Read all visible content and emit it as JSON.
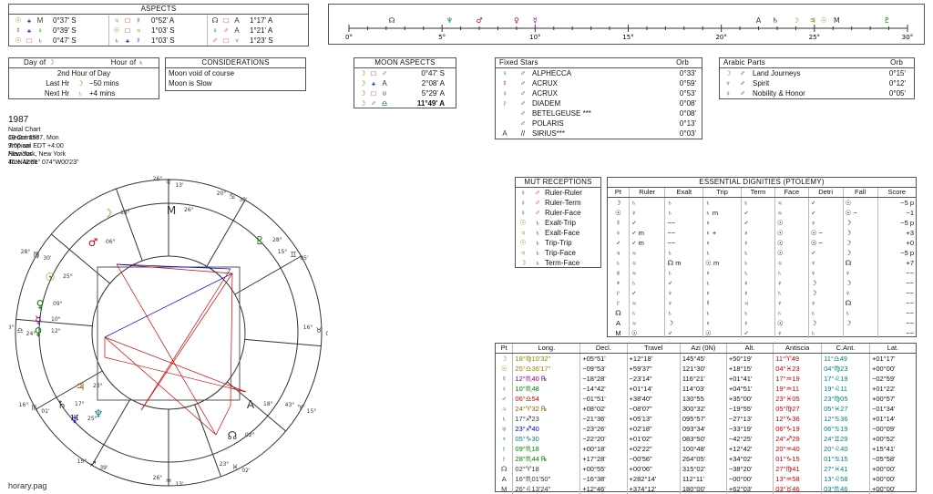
{
  "aspects": {
    "title": "ASPECTS",
    "cols": [
      [
        {
          "p1": "☉",
          "c1": "sun",
          "a": "⚹",
          "ca": "asp-b",
          "p2": "M",
          "c2": "sat",
          "orb": "0°37' S"
        },
        {
          "p1": "☿",
          "c1": "merc",
          "a": "⚹",
          "ca": "asp-b",
          "p2": "♀",
          "c2": "ven",
          "orb": "0°39' S"
        },
        {
          "p1": "☉",
          "c1": "sun",
          "a": "□",
          "ca": "asp-r",
          "p2": "♄",
          "c2": "sat",
          "orb": "0°47' S"
        }
      ],
      [
        {
          "p1": "♃",
          "c1": "jup",
          "a": "□",
          "ca": "asp-r",
          "p2": "☿",
          "c2": "merc",
          "orb": "0°52' A"
        },
        {
          "p1": "☉",
          "c1": "sun",
          "a": "□",
          "ca": "asp-r",
          "p2": "♃",
          "c2": "jup",
          "orb": "1°03' S"
        },
        {
          "p1": "♄",
          "c1": "sat",
          "a": "⚹",
          "ca": "asp-b",
          "p2": "☿",
          "c2": "merc",
          "orb": "1°03' S"
        }
      ],
      [
        {
          "p1": "☊",
          "c1": "sat",
          "a": "□",
          "ca": "asp-r",
          "p2": "A",
          "c2": "sat",
          "orb": "1°17' A"
        },
        {
          "p1": "♀",
          "c1": "ven",
          "a": "♂",
          "ca": "asp-r",
          "p2": "A",
          "c2": "sat",
          "orb": "1°21' A"
        },
        {
          "p1": "♂",
          "c1": "mars",
          "a": "□",
          "ca": "asp-r",
          "p2": "♆",
          "c2": "nep",
          "orb": "1°23' S"
        }
      ]
    ]
  },
  "timeline": {
    "ticks": [
      "0°",
      "5°",
      "10°",
      "15°",
      "20°",
      "25°",
      "30°"
    ],
    "markers": [
      {
        "g": "☊",
        "pos": 2.3,
        "c": "sat"
      },
      {
        "g": "♆",
        "pos": 5.4,
        "c": "nep"
      },
      {
        "g": "♂",
        "pos": 7.0,
        "c": "mars"
      },
      {
        "g": "♀",
        "pos": 9.0,
        "c": "mars"
      },
      {
        "g": "☿",
        "pos": 10.0,
        "c": "merc"
      },
      {
        "g": "A",
        "pos": 22.0,
        "c": "sat"
      },
      {
        "g": "♄",
        "pos": 22.9,
        "c": "sat"
      },
      {
        "g": "☽",
        "pos": 24.0,
        "c": "moon"
      },
      {
        "g": "☉",
        "pos": 25.5,
        "c": "sun"
      },
      {
        "g": "♃",
        "pos": 24.9,
        "c": "jup"
      },
      {
        "g": "M",
        "pos": 26.2,
        "c": "sat"
      },
      {
        "g": "♇",
        "pos": 28.9,
        "c": "ven"
      }
    ]
  },
  "day_of": {
    "title_left": "Day of",
    "title_right": "Hour of",
    "day_glyph": "☽",
    "hour_glyph": "♄",
    "rows": [
      {
        "label": "2nd Hour of Day",
        "g": "",
        "v": ""
      },
      {
        "label": "Last Hr",
        "g": "☽",
        "v": "−50 mins"
      },
      {
        "label": "Next Hr",
        "g": "♄",
        "v": "+4 mins"
      }
    ]
  },
  "considerations": {
    "title": "CONSIDERATIONS",
    "items": [
      "Moon void of course",
      "Moon is Slow"
    ]
  },
  "moon_aspects": {
    "title": "MOON ASPECTS",
    "rows": [
      {
        "p1": "☽",
        "a": "□",
        "ca": "asp-r",
        "p2": "♂",
        "c2": "mars",
        "orb": "0°47' S",
        "bold": false
      },
      {
        "p1": "☽",
        "a": "⚹",
        "ca": "asp-b",
        "p2": "A",
        "c2": "sat",
        "orb": "2°08' A",
        "bold": false
      },
      {
        "p1": "☽",
        "a": "□",
        "ca": "asp-r",
        "p2": "♅",
        "c2": "ura",
        "orb": "5°29' A",
        "bold": false
      },
      {
        "p1": "☽",
        "a": "♂",
        "ca": "sat",
        "p2": "♎",
        "c2": "ven",
        "orb": "11°49' A",
        "bold": true
      }
    ]
  },
  "fixed_stars": {
    "title": "Fixed Stars",
    "orb_label": "Orb",
    "rows": [
      {
        "p": "♀",
        "c": "ven",
        "a": "♂",
        "star": "ALPHECCA",
        "orb": "0°33'"
      },
      {
        "p": "☿",
        "c": "merc",
        "a": "♂",
        "star": "ACRUX",
        "orb": "0°59'"
      },
      {
        "p": "♀",
        "c": "ven",
        "a": "♂",
        "star": "ACRUX",
        "orb": "0°53'"
      },
      {
        "p": "♇",
        "c": "ven",
        "a": "♂",
        "star": "DIADEM",
        "orb": "0°08'"
      },
      {
        "p": "",
        "c": "sat",
        "a": "♂",
        "star": "BETELGEUSE ***",
        "orb": "0°08'"
      },
      {
        "p": "",
        "c": "sat",
        "a": "♂",
        "star": "POLARIS",
        "orb": "0°13'"
      },
      {
        "p": "A",
        "c": "sat",
        "a": "//",
        "star": "SIRIUS***",
        "orb": "0°03'"
      }
    ]
  },
  "arabic_parts": {
    "title": "Arabic Parts",
    "orb_label": "Orb",
    "rows": [
      {
        "p": "☽",
        "c": "moon",
        "a": "♂",
        "part": "Land Journeys",
        "orb": "0°15'"
      },
      {
        "p": "♆",
        "c": "nep",
        "a": "♂",
        "part": "Spirit",
        "orb": "0°12'"
      },
      {
        "p": "♀",
        "c": "ven",
        "a": "♂",
        "part": "Nobility & Honor",
        "orb": "0°05'"
      }
    ]
  },
  "chart_info": {
    "title": "1987",
    "lines": [
      "Natal Chart",
      "19 Oct 1987, Mon",
      "9:00 am  EDT +4:00",
      "New York, New York",
      "40°N42'51\" 074°W00'23\""
    ],
    "italic": [
      "Geocentric",
      "Tropical",
      "Placidus",
      "True Node"
    ]
  },
  "wheel": {
    "cusps": [
      {
        "label": "26°",
        "sign": "♌",
        "deg": "13'",
        "c": "sat"
      },
      {
        "label": "20°",
        "sign": "♋",
        "deg": "30'",
        "c": "sat"
      },
      {
        "label": "15°",
        "sign": "♊",
        "deg": "05'",
        "c": "sat"
      },
      {
        "label": "16°",
        "sign": "♉",
        "deg": "01'",
        "c": "sat"
      },
      {
        "label": "43°",
        "sign": "♈",
        "deg": "15°",
        "c": "sat"
      },
      {
        "label": "23°",
        "sign": "♓",
        "deg": "02'",
        "c": "sat"
      },
      {
        "label": "26°",
        "sign": "♒",
        "deg": "13'",
        "c": "sat"
      },
      {
        "label": "15°",
        "sign": "♐",
        "deg": "39'",
        "c": "sat"
      },
      {
        "label": "16°",
        "sign": "♏",
        "deg": "01'",
        "c": "sat"
      },
      {
        "label": "43°",
        "sign": "♎",
        "deg": "24°",
        "c": "sat"
      },
      {
        "label": "28°",
        "sign": "♍",
        "deg": "30'",
        "c": "sat"
      }
    ],
    "planets": [
      {
        "g": "☽",
        "c": "moon",
        "t": "18°"
      },
      {
        "g": "♂",
        "c": "mars",
        "t": "06°"
      },
      {
        "g": "☉",
        "c": "sun",
        "t": "25°"
      },
      {
        "g": "♀",
        "c": "ven",
        "t": "09°"
      },
      {
        "g": "☿",
        "c": "merc",
        "t": "10°"
      },
      {
        "g": "♀",
        "c": "ven",
        "t": "12°"
      },
      {
        "g": "♃",
        "c": "jup",
        "t": "23°"
      },
      {
        "g": "♄",
        "c": "sat",
        "t": "17°"
      },
      {
        "g": "♅",
        "c": "ura",
        "t": "25°"
      },
      {
        "g": "♆",
        "c": "nep",
        "t": ""
      },
      {
        "g": "♇",
        "c": "ven",
        "t": "28°"
      },
      {
        "g": "☊",
        "c": "sat",
        "t": "02°"
      },
      {
        "g": "A",
        "c": "sat",
        "t": "18°"
      },
      {
        "g": "M",
        "c": "sat",
        "t": "26°"
      }
    ]
  },
  "mut_receptions": {
    "title": "MUT RECEPTIONS",
    "rows": [
      {
        "p1": "♀",
        "c1": "ven",
        "p2": "♂",
        "c2": "mars",
        "txt": "Ruler-Ruler"
      },
      {
        "p1": "♀",
        "c1": "ven",
        "p2": "♂",
        "c2": "mars",
        "txt": "Ruler-Term"
      },
      {
        "p1": "♀",
        "c1": "ven",
        "p2": "♂",
        "c2": "mars",
        "txt": "Ruler-Face"
      },
      {
        "p1": "☉",
        "c1": "sun",
        "p2": "♄",
        "c2": "sat",
        "txt": "Exalt-Trip"
      },
      {
        "p1": "♃",
        "c1": "jup",
        "p2": "♄",
        "c2": "sat",
        "txt": "Exalt-Face"
      },
      {
        "p1": "☉",
        "c1": "sun",
        "p2": "♄",
        "c2": "sat",
        "txt": "Trip-Trip"
      },
      {
        "p1": "♃",
        "c1": "jup",
        "p2": "♄",
        "c2": "sat",
        "txt": "Trip-Face"
      },
      {
        "p1": "☽",
        "c1": "moon",
        "p2": "♄",
        "c2": "sat",
        "txt": "Term-Face"
      }
    ]
  },
  "dignities": {
    "title": "ESSENTIAL DIGNITIES (PTOLEMY)",
    "headers": [
      "Pt",
      "Ruler",
      "Exalt",
      "Trip",
      "Term",
      "Face",
      "Detri",
      "Fall",
      "Score"
    ],
    "rows": [
      [
        "☽",
        "♄",
        "♄",
        "♄",
        "♄",
        "♃",
        "♂",
        "☉",
        "−5 p"
      ],
      [
        "☉",
        "♀",
        "♄",
        "♄ m",
        "♂",
        "♃",
        "♂",
        "☉ −",
        "−1"
      ],
      [
        "☿",
        "♂",
        "−−",
        "♀",
        "♂",
        "☉",
        "♀",
        "☽",
        "−5 p"
      ],
      [
        "♀",
        "♂ m",
        "−−",
        "♀ +",
        "♀",
        "☉",
        "☉ −",
        "☽",
        "+3"
      ],
      [
        "♂",
        "♂ m",
        "−−",
        "♀",
        "♀",
        "☉",
        "☉ −",
        "☽",
        "+0"
      ],
      [
        "♃",
        "♃",
        "♄",
        "♄",
        "♄",
        "☉",
        "♂",
        "☽",
        "−5 p"
      ],
      [
        "♄",
        "♃",
        "☊ m",
        "☉ m",
        "♄",
        "♃",
        "♀",
        "☊",
        "+7"
      ],
      [
        "♅",
        "♃",
        "♄",
        "♀",
        "♄",
        "♄",
        "♀",
        "♀",
        "−−"
      ],
      [
        "♆",
        "♄",
        "♂",
        "♄",
        "♀",
        "♀",
        "☽",
        "☽",
        "−−"
      ],
      [
        "♇",
        "♂",
        "♀",
        "♀",
        "♀",
        "♄",
        "☽",
        "♀",
        "−−"
      ],
      [
        "♇",
        "♃",
        "♀",
        "☿",
        "♃",
        "♀",
        "♀",
        "☊",
        "−−"
      ],
      [
        "☊",
        "♄",
        "♄",
        "♄",
        "♄",
        "♄",
        "♄",
        "♄",
        "−−"
      ],
      [
        "A",
        "♃",
        "☽",
        "♀",
        "♀",
        "☉",
        "☽",
        "☽",
        "−−"
      ],
      [
        "M",
        "☉",
        "♂",
        "☉",
        "♂",
        "♀",
        "♄",
        "",
        "−−"
      ]
    ]
  },
  "positions": {
    "headers": [
      "Pt",
      "Long.",
      "Decl.",
      "Travel",
      "Azi (0N)",
      "Alt.",
      "Antiscia",
      "C.Ant.",
      "Lat."
    ],
    "rows": [
      {
        "pt": "☽",
        "c": "moon",
        "long": "18°♍10'32\"",
        "decl": "+05°51'",
        "travel": "+12°18'",
        "azi": "145°45'",
        "alt": "+50°19'",
        "anti": "11°♈49",
        "cant": "11°♎49",
        "lat": "+01°17'"
      },
      {
        "pt": "☉",
        "c": "sun",
        "long": "25°♎36'17\"",
        "decl": "−09°53'",
        "travel": "+59'37\"",
        "azi": "121°30'",
        "alt": "+18°15'",
        "anti": "04°♓23",
        "cant": "04°♍23",
        "lat": "+00°00'"
      },
      {
        "pt": "☿",
        "c": "merc",
        "long": "12°♏40 ℞",
        "decl": "−18°28'",
        "travel": "−23'14\"",
        "azi": "116°21'",
        "alt": "+01°41'",
        "anti": "17°♒19",
        "cant": "17°♌19",
        "lat": "−02°59'"
      },
      {
        "pt": "♀",
        "c": "ven",
        "long": "10°♏48",
        "decl": "−14°42'",
        "travel": "+01°14'",
        "azi": "114°03'",
        "alt": "+04°51'",
        "anti": "19°♒11",
        "cant": "19°♌11",
        "lat": "+01°22'"
      },
      {
        "pt": "♂",
        "c": "mars",
        "long": "06°♎54",
        "decl": "−01°51'",
        "travel": "+38'40\"",
        "azi": "130°55",
        "alt": "+35°00'",
        "anti": "23°♓05",
        "cant": "23°♍05",
        "lat": "+00°57'"
      },
      {
        "pt": "♃",
        "c": "jup",
        "long": "24°♈32 ℞",
        "decl": "+08°02'",
        "travel": "−08'07\"",
        "azi": "300°32'",
        "alt": "−19°55'",
        "anti": "05°♍27",
        "cant": "05°♓27",
        "lat": "−01°34'"
      },
      {
        "pt": "♄",
        "c": "sat",
        "long": "17°♐23",
        "decl": "−21°36'",
        "travel": "+05'13\"",
        "azi": "095°57'",
        "alt": "−27°13'",
        "anti": "12°♑36",
        "cant": "12°♋36",
        "lat": "+01°14'"
      },
      {
        "pt": "♅",
        "c": "ura",
        "long": "23°♐40",
        "decl": "−23°26'",
        "travel": "+02'18\"",
        "azi": "093°34'",
        "alt": "−33°19'",
        "anti": "06°♑19",
        "cant": "06°♋19",
        "lat": "−00°09'"
      },
      {
        "pt": "♆",
        "c": "nep",
        "long": "05°♑30",
        "decl": "−22°20'",
        "travel": "+01'02\"",
        "azi": "083°50'",
        "alt": "−42°25'",
        "anti": "24°♐29",
        "cant": "24°♊29",
        "lat": "+00°52'"
      },
      {
        "pt": "♇",
        "c": "ven",
        "long": "09°♏18",
        "decl": "+00°18'",
        "travel": "+02'22\"",
        "azi": "100°48'",
        "alt": "+12°42'",
        "anti": "20°♒40",
        "cant": "20°♌40",
        "lat": "+15°41'"
      },
      {
        "pt": "♇",
        "c": "ven",
        "long": "28°♏44 ℞",
        "decl": "+17°28'",
        "travel": "−00'56\"",
        "azi": "264°05'",
        "alt": "+34°02'",
        "anti": "01°♑15",
        "cant": "01°♋15",
        "lat": "−05°58'"
      },
      {
        "pt": "☊",
        "c": "sat",
        "long": "02°♈18",
        "decl": "+00°55'",
        "travel": "+00'06\"",
        "azi": "315°02'",
        "alt": "−38°20'",
        "anti": "27°♍41",
        "cant": "27°♓41",
        "lat": "+00°00'"
      },
      {
        "pt": "A",
        "c": "sat",
        "long": "16°♏01'50\"",
        "decl": "−16°38'",
        "travel": "+282°14'",
        "azi": "112°11'",
        "alt": "−00°00'",
        "anti": "13°♒58",
        "cant": "13°♌58",
        "lat": "+00°00'"
      },
      {
        "pt": "M",
        "c": "sat",
        "long": "26°♌13'24\"",
        "decl": "+12°46'",
        "travel": "+374°12'",
        "azi": "180°00'",
        "alt": "+62°03'",
        "anti": "03°♉46",
        "cant": "03°♏46",
        "lat": "+00°00'"
      }
    ]
  },
  "footer": "horary.pag",
  "colors": {
    "red": "#cc0000",
    "blue": "#0000cc",
    "green": "#008000",
    "border": "#555555"
  }
}
